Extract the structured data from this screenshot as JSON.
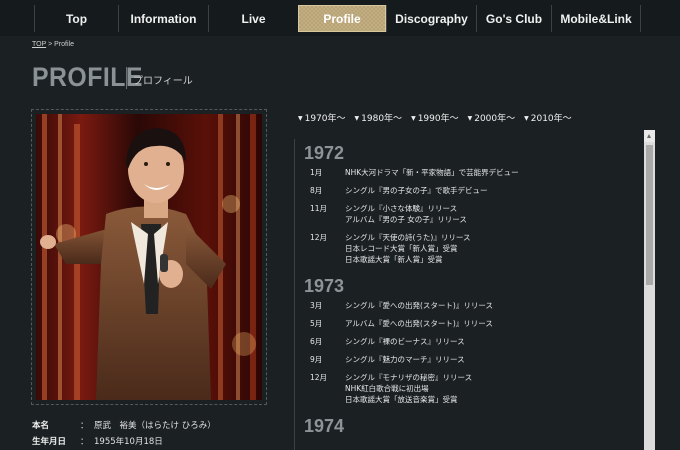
{
  "nav": {
    "items": [
      {
        "label": "Top"
      },
      {
        "label": "Information"
      },
      {
        "label": "Live"
      },
      {
        "label": "Profile",
        "active": true
      },
      {
        "label": "Discography"
      },
      {
        "label": "Go's Club"
      },
      {
        "label": "Mobile&Link"
      }
    ]
  },
  "breadcrumb": {
    "home": "TOP",
    "sep": " > ",
    "current": "Profile"
  },
  "page": {
    "title": "PROFILE",
    "subtitle": "プロフィール"
  },
  "profile": [
    {
      "key": "本名",
      "colon": "：",
      "value": "原武　裕美（はらたけ ひろみ）"
    },
    {
      "key": "生年月日",
      "colon": "：",
      "value": "1955年10月18日"
    }
  ],
  "decades": [
    "1970年〜",
    "1980年〜",
    "1990年〜",
    "2000年〜",
    "2010年〜"
  ],
  "timeline": [
    {
      "year": "1972",
      "events": [
        {
          "month": "1月",
          "lines": [
            "NHK大河ドラマ「新・平家物語」で芸能界デビュー"
          ]
        },
        {
          "month": "8月",
          "lines": [
            "シングル『男の子女の子』で歌手デビュー"
          ]
        },
        {
          "month": "11月",
          "lines": [
            "シングル『小さな体験』リリース",
            "アルバム『男の子 女の子』リリース"
          ]
        },
        {
          "month": "12月",
          "lines": [
            "シングル『天使の詩(うた)』リリース",
            "日本レコード大賞「新人賞」受賞",
            "日本歌謡大賞「新人賞」受賞"
          ]
        }
      ]
    },
    {
      "year": "1973",
      "events": [
        {
          "month": "3月",
          "lines": [
            "シングル『愛への出発(スタート)』リリース"
          ]
        },
        {
          "month": "5月",
          "lines": [
            "アルバム『愛への出発(スタート)』リリース"
          ]
        },
        {
          "month": "6月",
          "lines": [
            "シングル『裸のビーナス』リリース"
          ]
        },
        {
          "month": "9月",
          "lines": [
            "シングル『魅力のマーチ』リリース"
          ]
        },
        {
          "month": "12月",
          "lines": [
            "シングル『モナリザの秘密』リリース",
            "NHK紅白歌合戦に初出場",
            "日本歌謡大賞「放送音楽賞」受賞"
          ]
        }
      ]
    },
    {
      "year": "1974",
      "events": []
    }
  ],
  "icons": {
    "decade_arrow": "triangle-down-icon",
    "scroll_up": "scroll-up-arrow"
  },
  "colors": {
    "background": "#1b2023",
    "active_tab": "#b9a476",
    "year": "#8d9497"
  }
}
